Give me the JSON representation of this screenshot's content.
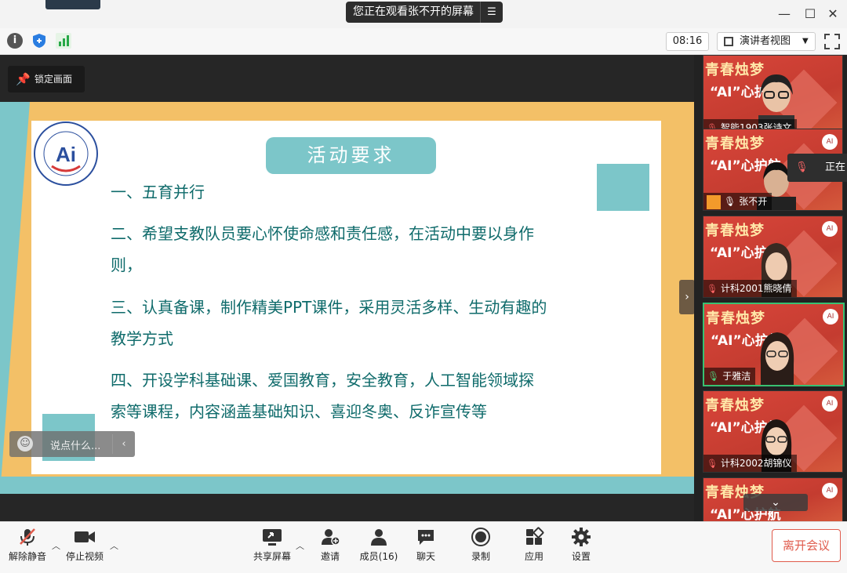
{
  "window": {
    "share_notice": "您正在观看张不开的屏幕",
    "share_menu_icon": "list-icon",
    "minimize_icon": "minimize-icon",
    "maximize_icon": "maximize-icon",
    "close_icon": "close-icon"
  },
  "infobar": {
    "timer": "08:16",
    "view_mode": "演讲者视图",
    "icons": [
      "info-icon",
      "shield-icon",
      "signal-icon"
    ]
  },
  "stage": {
    "lock_label": "锁定画面",
    "chat_placeholder": "说点什么...",
    "slide": {
      "title": "活动要求",
      "lines": [
        "一、五育并行",
        "二、希望支教队员要心怀使命感和责任感，在活动中要以身作",
        "则，",
        "三、认真备课，制作精美PPT课件，采用灵活多样、生动有趣的",
        "教学方式",
        "四、开设学科基础课、爱国教育，安全教育，人工智能领域探",
        "索等课程，内容涵盖基础知识、喜迎冬奥、反诈宣传等"
      ]
    }
  },
  "participants": {
    "poster_line1": "青春烛梦",
    "poster_line2": "“AI”心护航",
    "speaking_label": "正在",
    "tiles": [
      {
        "name": "智能1903张诗文",
        "muted": true
      },
      {
        "name": "张不开",
        "muted": false
      },
      {
        "name": "计科2001熊晓倩",
        "muted": true
      },
      {
        "name": "于雅洁",
        "muted": false
      },
      {
        "name": "计科2002胡锦仪",
        "muted": true
      }
    ]
  },
  "toolbar": {
    "mute_label": "解除静音",
    "video_label": "停止视频",
    "share_label": "共享屏幕",
    "invite_label": "邀请",
    "members_label": "成员(16)",
    "chat_label": "聊天",
    "record_label": "录制",
    "apps_label": "应用",
    "settings_label": "设置",
    "leave_label": "离开会议"
  },
  "colors": {
    "teal": "#7cc6c9",
    "slide_text": "#0f6b6b",
    "slide_bg": "#f3c067",
    "leave_red": "#e05b4c",
    "active_green": "#38c172"
  }
}
